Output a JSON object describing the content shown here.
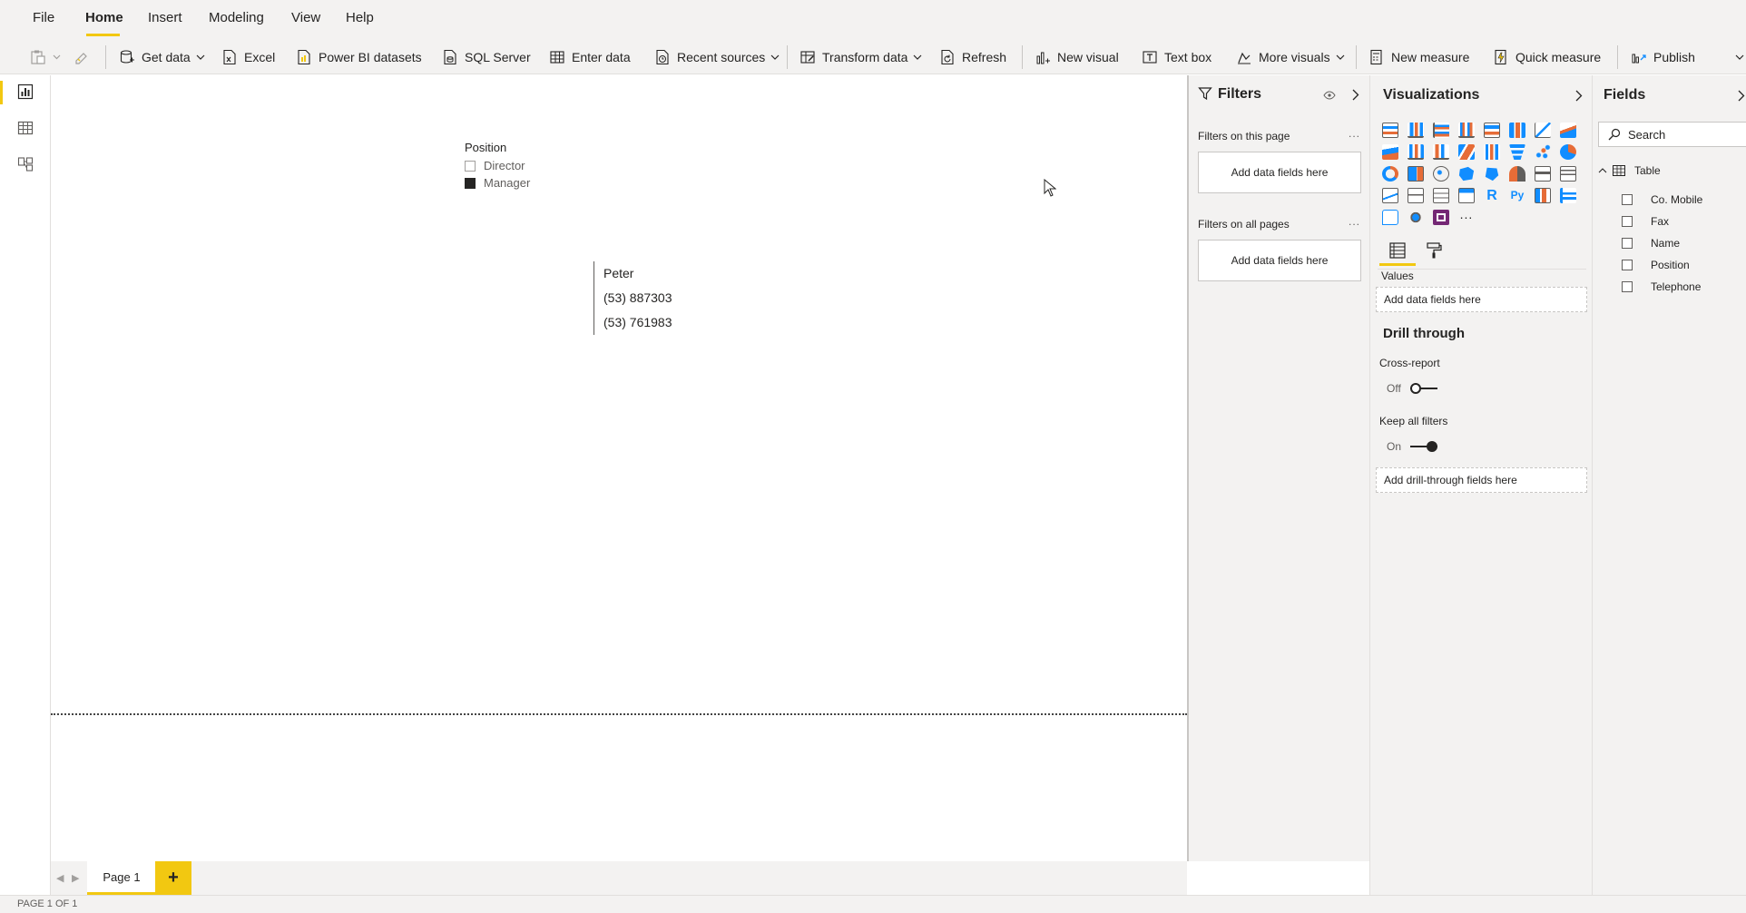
{
  "ribbon": {
    "menu": [
      "File",
      "Home",
      "Insert",
      "Modeling",
      "View",
      "Help"
    ],
    "active_menu": "Home",
    "toolbar": {
      "get_data": "Get data",
      "excel": "Excel",
      "power_bi_datasets": "Power BI datasets",
      "sql_server": "SQL Server",
      "enter_data": "Enter data",
      "recent_sources": "Recent sources",
      "transform_data": "Transform data",
      "refresh": "Refresh",
      "new_visual": "New visual",
      "text_box": "Text box",
      "more_visuals": "More visuals",
      "new_measure": "New measure",
      "quick_measure": "Quick measure",
      "publish": "Publish"
    }
  },
  "canvas": {
    "slicer": {
      "title": "Position",
      "items": [
        {
          "label": "Director",
          "selected": false
        },
        {
          "label": "Manager",
          "selected": true
        }
      ]
    },
    "card": {
      "lines": [
        "Peter",
        "(53) 887303",
        "(53) 761983"
      ]
    }
  },
  "pages": {
    "tab": "Page 1",
    "add": "+",
    "status": "PAGE 1 OF 1"
  },
  "filters": {
    "title": "Filters",
    "on_this_page": "Filters on this page",
    "on_all_pages": "Filters on all pages",
    "add_fields": "Add data fields here",
    "more": "..."
  },
  "visualizations": {
    "title": "Visualizations",
    "values_label": "Values",
    "values_drop": "Add data fields here",
    "drill_through": {
      "title": "Drill through",
      "cross_report": "Cross-report",
      "cross_report_state": "Off",
      "keep_all_filters": "Keep all filters",
      "keep_all_filters_state": "On",
      "drop": "Add drill-through fields here"
    },
    "icons": [
      "stacked-bar-chart-icon",
      "stacked-column-chart-icon",
      "clustered-bar-chart-icon",
      "clustered-column-chart-icon",
      "100-stacked-bar-chart-icon",
      "100-stacked-column-chart-icon",
      "line-chart-icon",
      "area-chart-icon",
      "stacked-area-chart-icon",
      "line-and-stacked-column-chart-icon",
      "line-and-clustered-column-chart-icon",
      "ribbon-chart-icon",
      "waterfall-chart-icon",
      "funnel-chart-icon",
      "scatter-chart-icon",
      "pie-chart-icon",
      "donut-chart-icon",
      "treemap-icon",
      "map-icon",
      "filled-map-icon",
      "shape-map-icon",
      "gauge-icon",
      "card-icon",
      "multi-row-card-icon",
      "kpi-icon",
      "slicer-icon",
      "table-icon",
      "matrix-icon",
      "r-script-visual-icon",
      "python-visual-icon",
      "key-influencers-icon",
      "decomposition-tree-icon",
      "qa-icon",
      "smart-narrative-icon",
      "power-apps-icon",
      "more-visuals-icon"
    ]
  },
  "fields": {
    "title": "Fields",
    "search_placeholder": "Search",
    "table_name": "Table",
    "items": [
      "Co. Mobile",
      "Fax",
      "Name",
      "Position",
      "Telephone"
    ]
  },
  "colors": {
    "accent": "#f2c811",
    "pane_bg": "#f3f2f1",
    "viz_blue": "#118dff",
    "viz_orange": "#e66c37",
    "viz_purple": "#6b007b",
    "text": "#252423"
  }
}
